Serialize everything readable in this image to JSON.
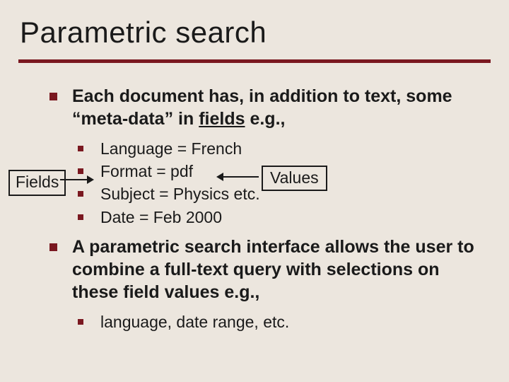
{
  "title": "Parametric search",
  "point1_prefix": "Each document has, in addition to text, some “meta-data” in ",
  "point1_underlined": "fields",
  "point1_suffix": " e.g.,",
  "sub": {
    "s1": "Language = French",
    "s2": "Format = pdf",
    "s3": "Subject = Physics etc.",
    "s4": "Date = Feb 2000"
  },
  "labels": {
    "fields": "Fields",
    "values": "Values"
  },
  "point2": "A parametric search interface allows the user to combine a full-text query with selections on these field values e.g.,",
  "sub2": {
    "s1": "language, date range, etc."
  }
}
